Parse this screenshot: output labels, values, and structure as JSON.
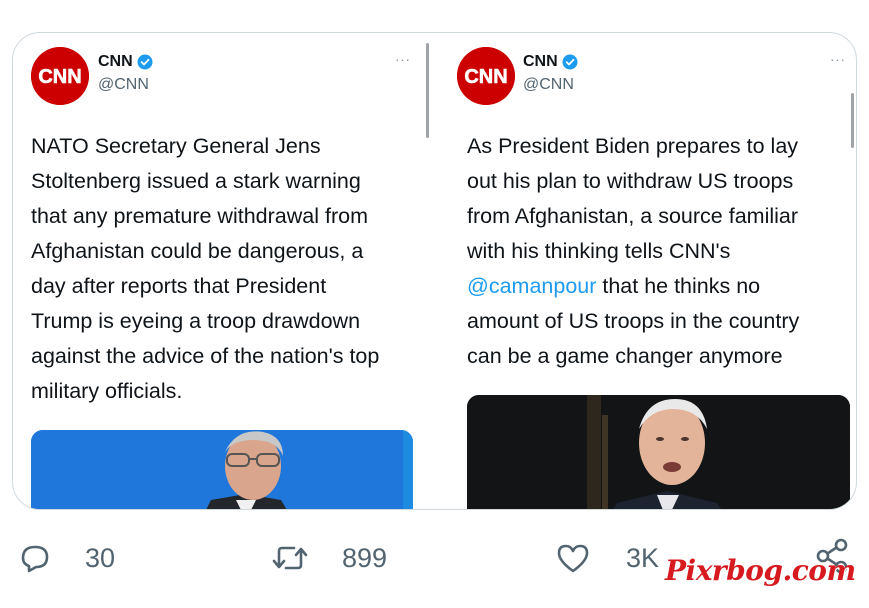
{
  "tweets": [
    {
      "name": "CNN",
      "handle": "@CNN",
      "more": "···",
      "avatar_text": "CNN",
      "lines": [
        "NATO Secretary General Jens",
        "Stoltenberg issued a stark warning",
        "that any premature withdrawal from",
        "Afghanistan could be dangerous, a",
        "day after reports that President",
        "Trump is eyeing a troop drawdown",
        "against the advice of the nation's top",
        "military officials."
      ]
    },
    {
      "name": "CNN",
      "handle": "@CNN",
      "more": "···",
      "avatar_text": "CNN",
      "lines": [
        "As President Biden prepares to lay",
        "out his plan to withdraw US troops",
        "from Afghanistan, a source familiar",
        "with his thinking tells CNN's",
        "",
        "amount of US troops in the country",
        "can be a game changer anymore"
      ],
      "mention": "@camanpour",
      "mention_rest": " that he thinks no"
    }
  ],
  "actions": {
    "reply_count": "30",
    "retweet_count": "899",
    "like_count": "3K"
  },
  "watermark": "Pixrbog.com",
  "colors": {
    "brand_red": "#cc0000",
    "verified_blue": "#1d9bf0",
    "mention_blue": "#1d9bf0",
    "muted": "#536471",
    "watermark_red": "#d71920"
  },
  "icons": {
    "reply": "speech-bubble-icon",
    "retweet": "retweet-icon",
    "like": "heart-icon",
    "share": "share-icon",
    "verified": "verified-badge-icon",
    "more": "more-dots-icon"
  }
}
